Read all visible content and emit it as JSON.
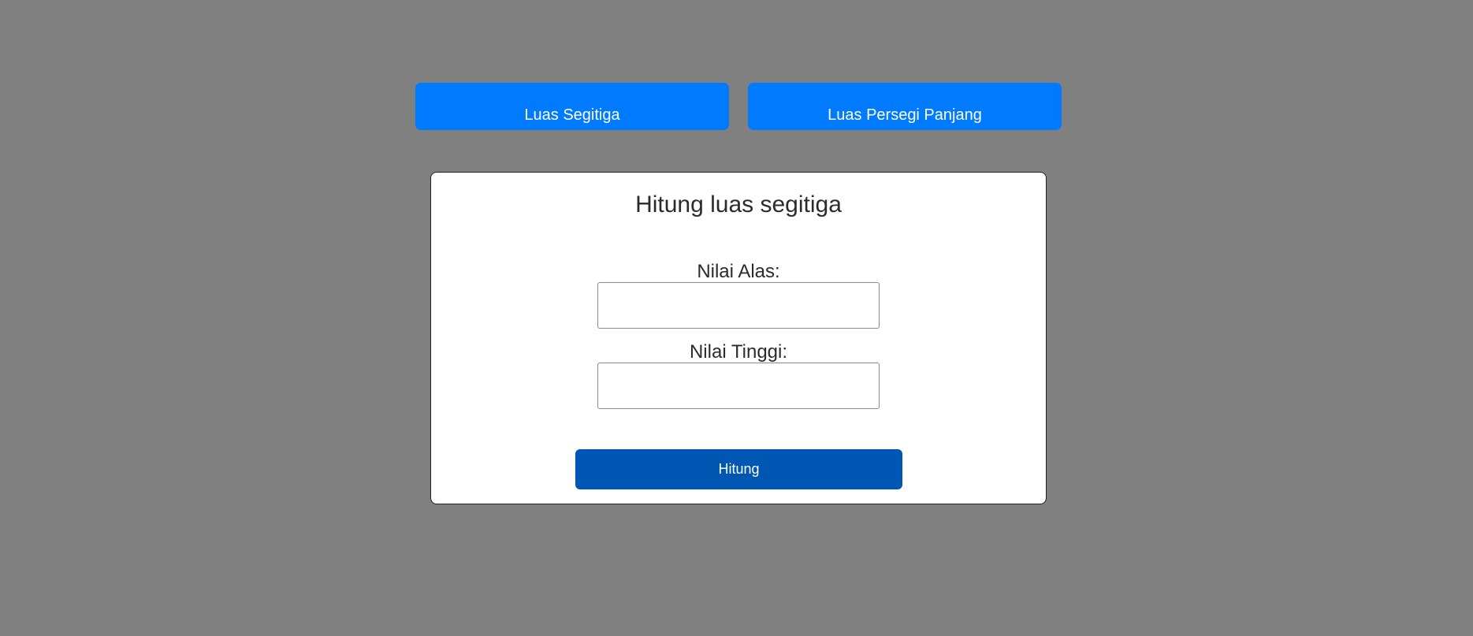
{
  "nav": {
    "triangle_label": "Luas Segitiga",
    "rectangle_label": "Luas Persegi Panjang",
    "accent_color": "#007bff"
  },
  "form": {
    "title": "Hitung luas segitiga",
    "base_label": "Nilai Alas:",
    "base_value": "",
    "height_label": "Nilai Tinggi:",
    "height_value": "",
    "submit_label": "Hitung",
    "submit_color": "#0056b3"
  },
  "page": {
    "background_color": "#808080"
  }
}
